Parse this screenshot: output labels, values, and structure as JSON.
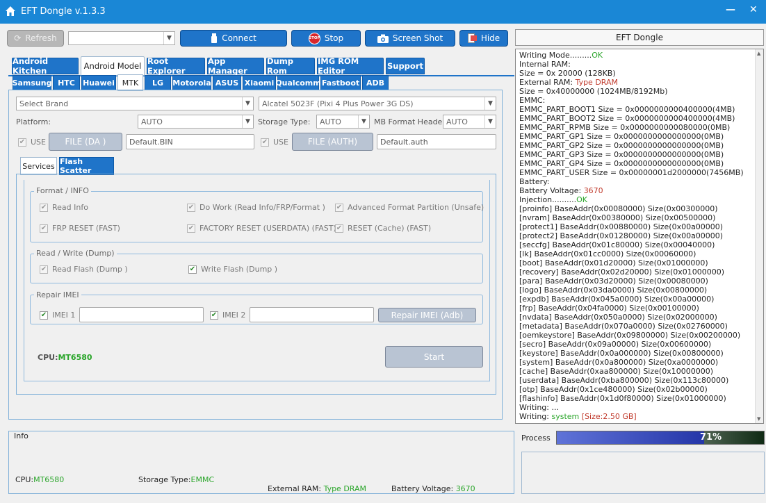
{
  "window": {
    "title": "EFT Dongle  v.1.3.3",
    "min": "—",
    "close": "✕"
  },
  "toolbar": {
    "refresh": "Refresh",
    "combo_value": "",
    "connect": "Connect",
    "stop": "Stop",
    "stop_badge": "STOP",
    "screenshot": "Screen Shot",
    "hide": "Hide",
    "right_title": "EFT Dongle"
  },
  "tabs": [
    "Android Kitchen",
    "Android Model",
    "Root Explorer",
    "App Manager",
    "Dump Rom",
    "IMG ROM Editor",
    "Support"
  ],
  "brand_tabs": [
    "Samsung",
    "HTC",
    "Huawei",
    "MTK",
    "LG",
    "Motorola",
    "ASUS",
    "Xiaomi",
    "Qualcomm",
    "Fastboot",
    "ADB"
  ],
  "form": {
    "brand_placeholder": "Select Brand",
    "model_value": "Alcatel 5023F (Pixi 4 Plus Power 3G DS)",
    "platform_label": "Platform:",
    "platform_value": "AUTO",
    "storage_label": "Storage Type:",
    "storage_value": "AUTO",
    "mb_label": "MB Format Header",
    "mb_value": "AUTO",
    "use_label": "USE",
    "file_da": "FILE (DA )",
    "file_da_path": "Default.BIN",
    "file_auth": "FILE (AUTH)",
    "file_auth_path": "Default.auth"
  },
  "inner_tabs": [
    "Services",
    "Flash Scatter"
  ],
  "groups": {
    "format_title": "Format / INFO",
    "read_info": "Read Info",
    "do_work": "Do Work (Read Info/FRP/Format )",
    "adv_format": "Advanced Format Partition (Unsafe)",
    "frp_reset": "FRP RESET (FAST)",
    "factory_reset": "FACTORY RESET (USERDATA) (FAST)",
    "reset_cache": "RESET (Cache) (FAST)",
    "rw_title": "Read / Write (Dump)",
    "read_flash": "Read Flash (Dump )",
    "write_flash": "Write Flash (Dump )",
    "imei_title": "Repair IMEI",
    "imei1": "IMEI 1",
    "imei2": "IMEI 2",
    "repair_imei_btn": "Repair IMEI (Adb)"
  },
  "cpu": {
    "label": "CPU:",
    "value": "MT6580"
  },
  "start_button": "Start",
  "info": {
    "title": "Info",
    "cpu_label": "CPU:",
    "cpu_value": "MT6580",
    "storage_label": "Storage Type:",
    "storage_value": "EMMC",
    "ram_label": "External RAM: ",
    "ram_value": "Type DRAM",
    "batt_label": "Battery Voltage: ",
    "batt_value": "3670"
  },
  "process": {
    "label": "Process",
    "percent_text": "71%",
    "percent": 71
  },
  "log": [
    {
      "t": "Writing Mode.........",
      "s": "OK",
      "c": "ok"
    },
    {
      "t": "Internal RAM:"
    },
    {
      "t": "Size = 0x 20000 (128KB)"
    },
    {
      "t": "External RAM: ",
      "s": "Type DRAM",
      "c": "red"
    },
    {
      "t": "Size = 0x40000000 (1024MB/8192Mb)"
    },
    {
      "t": "EMMC:"
    },
    {
      "t": "EMMC_PART_BOOT1 Size = 0x0000000000400000(4MB)"
    },
    {
      "t": "EMMC_PART_BOOT2 Size = 0x0000000000400000(4MB)"
    },
    {
      "t": "EMMC_PART_RPMB Size = 0x0000000000080000(0MB)"
    },
    {
      "t": "EMMC_PART_GP1 Size = 0x0000000000000000(0MB)"
    },
    {
      "t": "EMMC_PART_GP2 Size = 0x0000000000000000(0MB)"
    },
    {
      "t": "EMMC_PART_GP3 Size = 0x0000000000000000(0MB)"
    },
    {
      "t": "EMMC_PART_GP4 Size = 0x0000000000000000(0MB)"
    },
    {
      "t": "EMMC_PART_USER Size = 0x00000001d2000000(7456MB)"
    },
    {
      "t": "Battery:"
    },
    {
      "t": "Battery Voltage: ",
      "s": "3670",
      "c": "red"
    },
    {
      "t": "Injection..........",
      "s": "OK",
      "c": "ok"
    },
    {
      "t": "[proinfo] BaseAddr(0x00080000) Size(0x00300000)"
    },
    {
      "t": "[nvram] BaseAddr(0x00380000) Size(0x00500000)"
    },
    {
      "t": "[protect1] BaseAddr(0x00880000) Size(0x00a00000)"
    },
    {
      "t": "[protect2] BaseAddr(0x01280000) Size(0x00a00000)"
    },
    {
      "t": "[seccfg] BaseAddr(0x01c80000) Size(0x00040000)"
    },
    {
      "t": "[lk] BaseAddr(0x01cc0000) Size(0x00060000)"
    },
    {
      "t": "[boot] BaseAddr(0x01d20000) Size(0x01000000)"
    },
    {
      "t": "[recovery] BaseAddr(0x02d20000) Size(0x01000000)"
    },
    {
      "t": "[para] BaseAddr(0x03d20000) Size(0x00080000)"
    },
    {
      "t": "[logo] BaseAddr(0x03da0000) Size(0x00800000)"
    },
    {
      "t": "[expdb] BaseAddr(0x045a0000) Size(0x00a00000)"
    },
    {
      "t": "[frp] BaseAddr(0x04fa0000) Size(0x00100000)"
    },
    {
      "t": "[nvdata] BaseAddr(0x050a0000) Size(0x02000000)"
    },
    {
      "t": "[metadata] BaseAddr(0x070a0000) Size(0x02760000)"
    },
    {
      "t": "[oemkeystore] BaseAddr(0x09800000) Size(0x00200000)"
    },
    {
      "t": "[secro] BaseAddr(0x09a00000) Size(0x00600000)"
    },
    {
      "t": "[keystore] BaseAddr(0x0a000000) Size(0x00800000)"
    },
    {
      "t": "[system] BaseAddr(0x0a800000) Size(0xa0000000)"
    },
    {
      "t": "[cache] BaseAddr(0xaa800000) Size(0x10000000)"
    },
    {
      "t": "[userdata] BaseAddr(0xba800000) Size(0x113c80000)"
    },
    {
      "t": "[otp] BaseAddr(0x1ce480000) Size(0x02b00000)"
    },
    {
      "t": "[flashinfo] BaseAddr(0x1d0f80000) Size(0x01000000)"
    },
    {
      "t": "Writing: ..."
    },
    {
      "t": "Writing: ",
      "s": "system",
      "c": "green",
      "s2": " [Size:2.50 GB]",
      "c2": "red"
    }
  ],
  "colors": {
    "titlebar": "#1a87d6",
    "button": "#1f74c9",
    "progress": "#3e4fc9",
    "ok": "#2aa52a",
    "error": "#c0392b"
  }
}
